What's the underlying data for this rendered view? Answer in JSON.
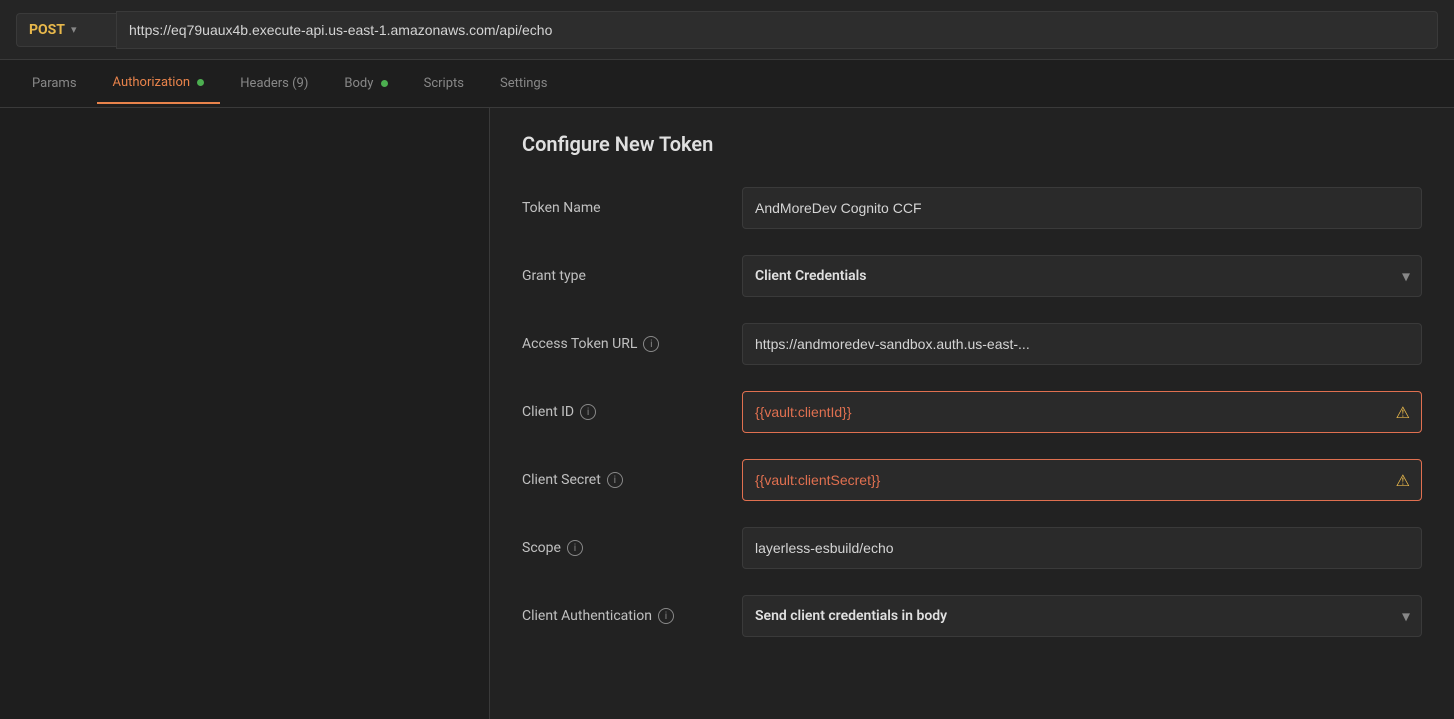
{
  "url_bar": {
    "method": "POST",
    "url": "https://eq79uaux4b.execute-api.us-east-1.amazonaws.com/api/echo"
  },
  "tabs": [
    {
      "id": "params",
      "label": "Params",
      "active": false,
      "dot": null
    },
    {
      "id": "authorization",
      "label": "Authorization",
      "active": true,
      "dot": "green"
    },
    {
      "id": "headers",
      "label": "Headers (9)",
      "active": false,
      "dot": null
    },
    {
      "id": "body",
      "label": "Body",
      "active": false,
      "dot": "green"
    },
    {
      "id": "scripts",
      "label": "Scripts",
      "active": false,
      "dot": null
    },
    {
      "id": "settings",
      "label": "Settings",
      "active": false,
      "dot": null
    }
  ],
  "configure_token": {
    "title": "Configure New Token",
    "fields": {
      "token_name": {
        "label": "Token Name",
        "value": "AndMoreDev Cognito CCF",
        "has_info": false
      },
      "grant_type": {
        "label": "Grant type",
        "value": "Client Credentials",
        "has_info": false
      },
      "access_token_url": {
        "label": "Access Token URL",
        "value": "https://andmoredev-sandbox.auth.us-east-...",
        "has_info": true
      },
      "client_id": {
        "label": "Client ID",
        "value": "{{vault:clientId}}",
        "has_info": true,
        "is_vault": true,
        "has_warning": true
      },
      "client_secret": {
        "label": "Client Secret",
        "value": "{{vault:clientSecret}}",
        "has_info": true,
        "is_vault": true,
        "has_warning": true
      },
      "scope": {
        "label": "Scope",
        "value": "layerless-esbuild/echo",
        "has_info": true
      },
      "client_authentication": {
        "label": "Client Authentication",
        "value": "Send client credentials in body",
        "has_info": true
      }
    }
  },
  "icons": {
    "chevron_down": "▾",
    "info": "i",
    "warning": "⚠"
  }
}
